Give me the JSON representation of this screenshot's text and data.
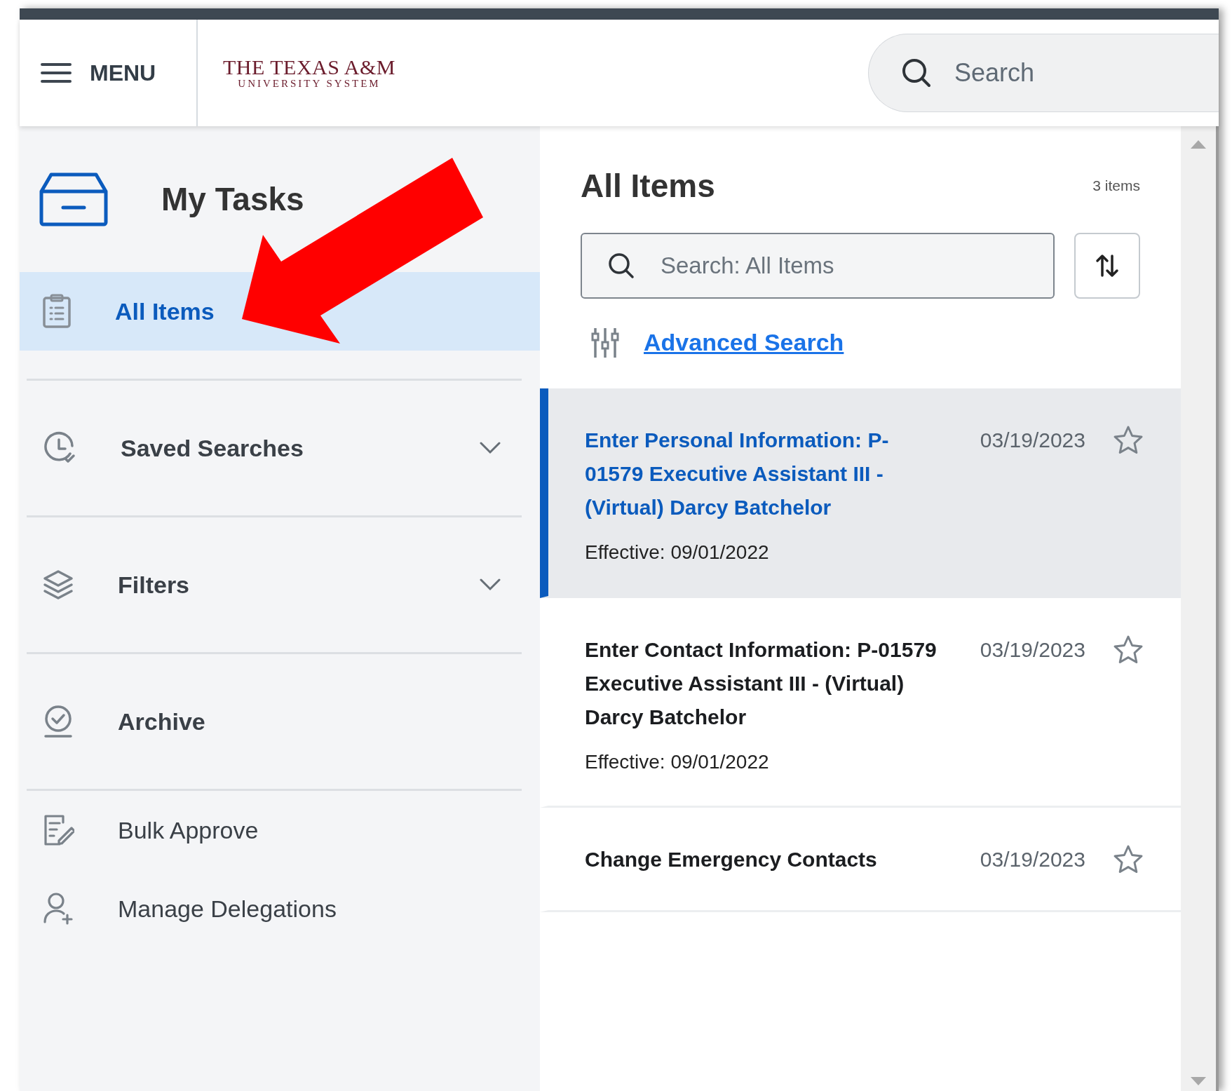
{
  "header": {
    "menu_label": "MENU",
    "logo": {
      "line1": "THE TEXAS A&M",
      "line2": "UNIVERSITY SYSTEM"
    },
    "search": {
      "placeholder": "Search"
    }
  },
  "sidebar": {
    "title": "My Tasks",
    "items": [
      {
        "label": "All Items",
        "kind": "nav",
        "selected": true
      },
      {
        "label": "Saved Searches",
        "kind": "expandable",
        "selected": false,
        "expanded": false
      },
      {
        "label": "Filters",
        "kind": "expandable",
        "selected": false,
        "expanded": false
      },
      {
        "label": "Archive",
        "kind": "nav",
        "selected": false
      },
      {
        "label": "Bulk Approve",
        "kind": "action",
        "selected": false
      },
      {
        "label": "Manage Delegations",
        "kind": "action",
        "selected": false
      }
    ]
  },
  "main": {
    "title": "All Items",
    "count": "3 items",
    "search": {
      "placeholder": "Search: All Items"
    },
    "advanced_search": "Advanced Search",
    "items": [
      {
        "title": "Enter Personal Information: P-01579 Executive Assistant III - (Virtual) Darcy Batchelor",
        "date": "03/19/2023",
        "effective": "Effective: 09/01/2022",
        "selected": true,
        "starred": false
      },
      {
        "title": "Enter Contact Information: P-01579 Executive Assistant III - (Virtual) Darcy Batchelor",
        "date": "03/19/2023",
        "effective": "Effective: 09/01/2022",
        "selected": false,
        "starred": false
      },
      {
        "title": "Change Emergency Contacts",
        "date": "03/19/2023",
        "selected": false,
        "starred": false
      }
    ]
  }
}
